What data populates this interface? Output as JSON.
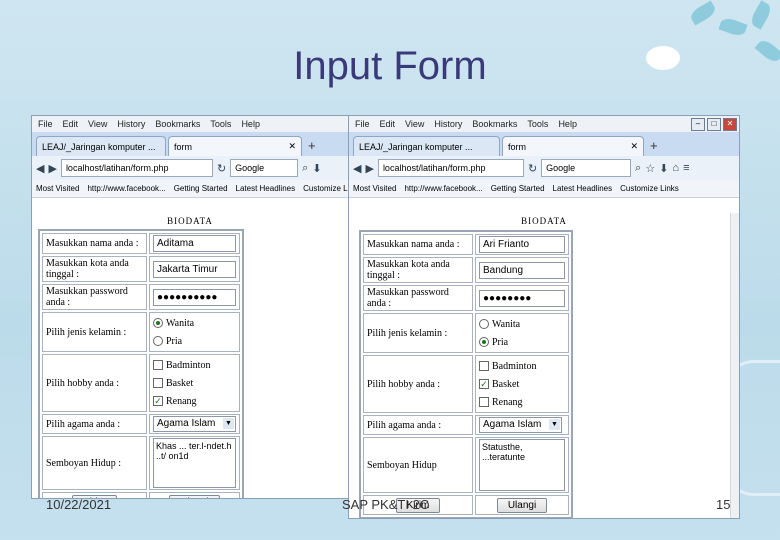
{
  "slide": {
    "title": "Input Form",
    "date": "10/22/2021",
    "course": "SAP PK&TI 2C",
    "page": "15"
  },
  "browser": {
    "menu": [
      "File",
      "Edit",
      "View",
      "History",
      "Bookmarks",
      "Tools",
      "Help"
    ],
    "tabs": [
      {
        "label": "LEAJ/_Jaringan komputer ..."
      },
      {
        "label": "form"
      }
    ],
    "new_tab": "+",
    "url": "localhost/latihan/form.php",
    "search_placeholder": "Google",
    "bookmarks": [
      "Most Visited",
      "http://www.facebook...",
      "Getting Started",
      "Latest Headlines",
      "Customize Links"
    ]
  },
  "form": {
    "title": "BIODATA",
    "labels": {
      "name": "Masukkan nama anda :",
      "city": "Masukkan kota anda tinggal :",
      "password": "Masukkan password anda :",
      "gender": "Pilih jenis kelamin :",
      "hobby": "Pilih hobby anda :",
      "religion": "Pilih agama anda :",
      "motto": "Semboyan Hidup :",
      "motto_right": "Semboyan Hidup"
    },
    "gender_options": [
      "Wanita",
      "Pria"
    ],
    "hobby_options": [
      "Badminton",
      "Basket",
      "Renang"
    ],
    "submit_label": "Kirim",
    "reset_label": "Ulangi"
  },
  "left_window": {
    "name": "Aditama",
    "city": "Jakarta Timur",
    "password_mask": "●●●●●●●●●●",
    "gender_selected": "Wanita",
    "hobby_checked": [
      "Renang"
    ],
    "religion": "Agama Islam",
    "motto": "Khas ... ter.l-ndet.h  ..t/ on1d"
  },
  "right_window": {
    "name": "Ari Frianto",
    "city": "Bandung",
    "password_mask": "●●●●●●●●",
    "gender_selected": "Pria",
    "hobby_checked": [
      "Basket"
    ],
    "religion": "Agama Islam",
    "motto": "Statusthe, ...teratunte"
  },
  "colors": {
    "title": "#3a3a7a",
    "background": "#c5e0ee",
    "check": "#1a7a1a"
  }
}
